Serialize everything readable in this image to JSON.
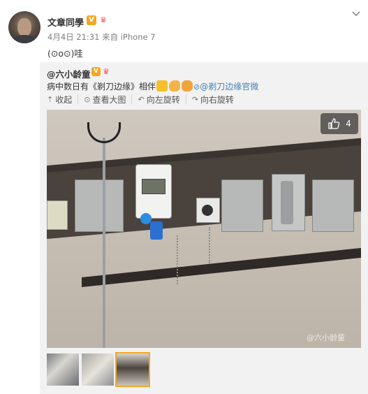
{
  "post": {
    "author": "文章同學",
    "verified_badge": "V",
    "meta": "4月4日 21:31 来自 iPhone 7",
    "text": "(⊙o⊙)哇"
  },
  "repost": {
    "author": "@六小龄童",
    "verified_badge": "V",
    "text_before": "病中数日有《剃刀边缘》相伴",
    "link_text": "剃刀边缘官微",
    "toolbar": {
      "collapse": "收起",
      "view_large": "查看大图",
      "rotate_left": "向左旋转",
      "rotate_right": "向右旋转"
    },
    "photo": {
      "like_count": "4",
      "watermark": "@六小龄童"
    },
    "thumbnails": [
      "thumb-1",
      "thumb-2",
      "thumb-3"
    ]
  },
  "icons": {
    "more": "chevron-down-icon",
    "collapse": "arrow-up-icon",
    "view": "magnifier-icon",
    "rotate_left": "rotate-left-icon",
    "rotate_right": "rotate-right-icon",
    "like": "thumbs-up-icon"
  },
  "colors": {
    "link": "#467fb5",
    "badge": "#f5a623",
    "repost_bg": "#f2f2f2"
  }
}
